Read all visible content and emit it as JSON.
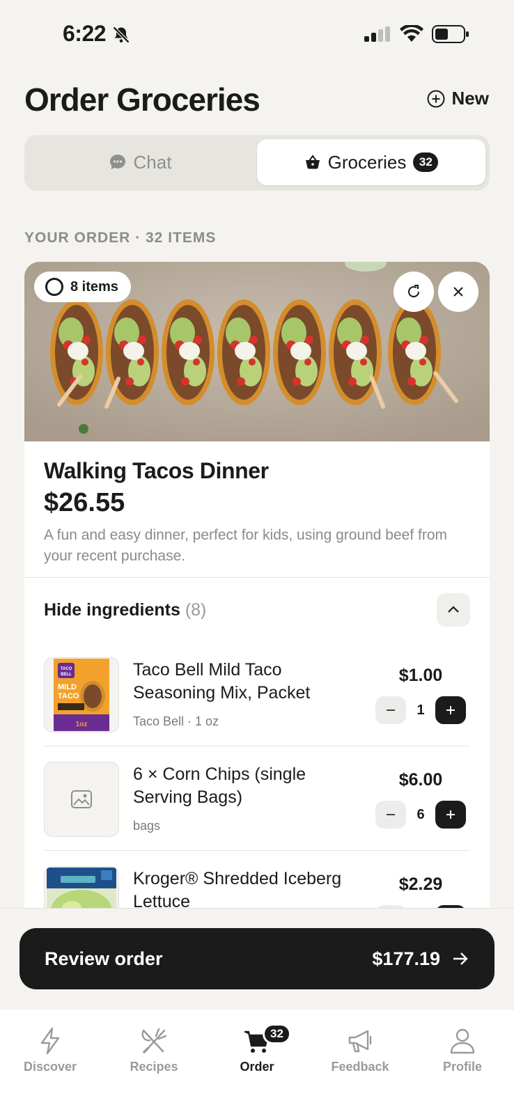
{
  "status_bar": {
    "time": "6:22"
  },
  "header": {
    "title": "Order Groceries",
    "new_label": "New"
  },
  "segments": {
    "chat_label": "Chat",
    "groceries_label": "Groceries",
    "groceries_count": "32"
  },
  "order": {
    "section_label": "YOUR ORDER · 32 ITEMS"
  },
  "meal": {
    "items_pill": "8 items",
    "title": "Walking Tacos Dinner",
    "price": "$26.55",
    "description": "A fun and easy dinner, perfect for kids, using ground beef from your recent purchase."
  },
  "ingredients": {
    "toggle_label": "Hide ingredients",
    "count": "(8)",
    "items": [
      {
        "name": "Taco Bell Mild Taco Seasoning Mix, Packet",
        "meta": "Taco Bell · 1 oz",
        "price": "$1.00",
        "qty": "1"
      },
      {
        "name": "6 × Corn Chips (single Serving Bags)",
        "meta": "bags",
        "price": "$6.00",
        "qty": "6"
      },
      {
        "name": "Kroger® Shredded Iceberg Lettuce",
        "meta": "",
        "price": "$2.29",
        "qty": ""
      }
    ]
  },
  "review": {
    "label": "Review order",
    "total": "$177.19"
  },
  "tabbar": {
    "discover": "Discover",
    "recipes": "Recipes",
    "order": "Order",
    "order_badge": "32",
    "feedback": "Feedback",
    "profile": "Profile"
  }
}
